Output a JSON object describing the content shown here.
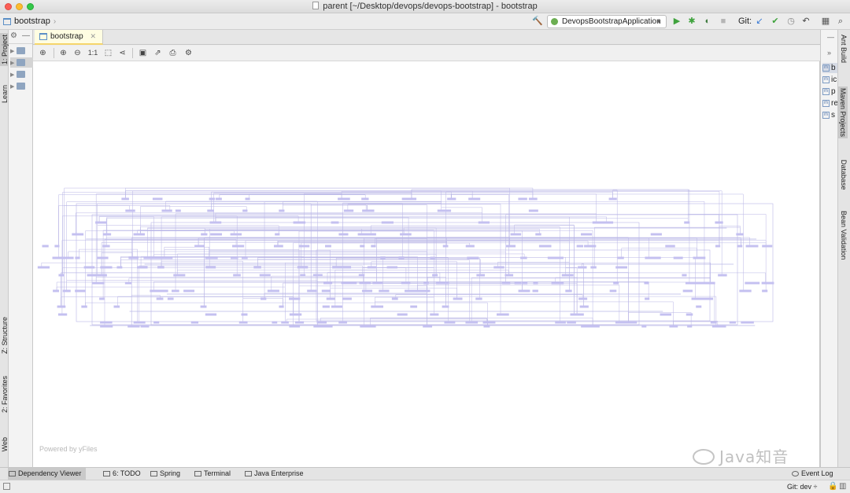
{
  "window": {
    "title": "parent [~/Desktop/devops/devops-bootstrap] - bootstrap"
  },
  "navbar": {
    "breadcrumb": "bootstrap",
    "run_config": "DevopsBootstrapApplication",
    "git_label": "Git:"
  },
  "left_stripe": {
    "tabs": [
      "1: Project",
      "Learn",
      "Z: Structure",
      "2: Favorites",
      "Web"
    ]
  },
  "editor": {
    "tab_label": "bootstrap",
    "zoom_label": "1:1",
    "powered_by": "Powered by yFiles"
  },
  "right_panel": {
    "items": [
      "b",
      "ic",
      "p",
      "re",
      "s"
    ]
  },
  "right_stripe": {
    "tabs": [
      "Ant Build",
      "Maven Projects",
      "Database",
      "Bean Validation"
    ]
  },
  "bottom_bar": {
    "tabs": [
      "Dependency Viewer",
      "6: TODO",
      "Spring",
      "Terminal",
      "Java Enterprise"
    ],
    "event_log": "Event Log"
  },
  "status_bar": {
    "git_branch": "Git: dev ÷"
  },
  "watermark": "Java知音",
  "colors": {
    "graph_line": "#b9b6e6",
    "graph_node": "#c4c0f0",
    "tab_highlight": "#f5d56b",
    "run_green": "#3fa33d"
  }
}
